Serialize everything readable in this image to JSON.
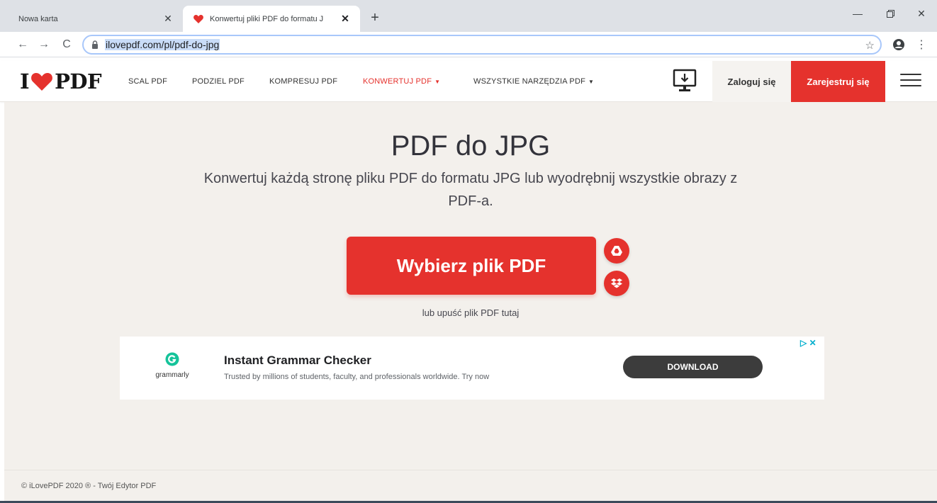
{
  "browser": {
    "tabs": [
      {
        "title": "Nowa karta",
        "active": false
      },
      {
        "title": "Konwertuj pliki PDF do formatu J",
        "active": true
      }
    ],
    "url": "ilovepdf.com/pl/pdf-do-jpg"
  },
  "site": {
    "logo": {
      "left": "I",
      "right": "PDF"
    },
    "nav": [
      {
        "label": "SCAL PDF",
        "dropdown": false
      },
      {
        "label": "PODZIEL PDF",
        "dropdown": false
      },
      {
        "label": "KOMPRESUJ PDF",
        "dropdown": false
      },
      {
        "label": "KONWERTUJ PDF",
        "dropdown": true,
        "active": true
      },
      {
        "label": "WSZYSTKIE NARZĘDZIA PDF",
        "dropdown": true
      }
    ],
    "login": "Zaloguj się",
    "signup": "Zarejestruj się"
  },
  "main": {
    "title": "PDF do JPG",
    "subtitle": "Konwertuj każdą stronę pliku PDF do formatu JPG lub wyodrębnij wszystkie obrazy z PDF-a.",
    "select_button": "Wybierz plik PDF",
    "drop_hint": "lub upuść plik PDF tutaj"
  },
  "ad": {
    "brand": "grammarly",
    "title": "Instant Grammar Checker",
    "description": "Trusted by millions of students, faculty, and professionals worldwide. Try now",
    "cta": "DOWNLOAD"
  },
  "footer": {
    "text": "© iLovePDF 2020 ® - Twój Edytor PDF"
  },
  "colors": {
    "accent": "#e5322d",
    "page_bg": "#f3f0ec",
    "grammarly_green": "#15c39a"
  }
}
